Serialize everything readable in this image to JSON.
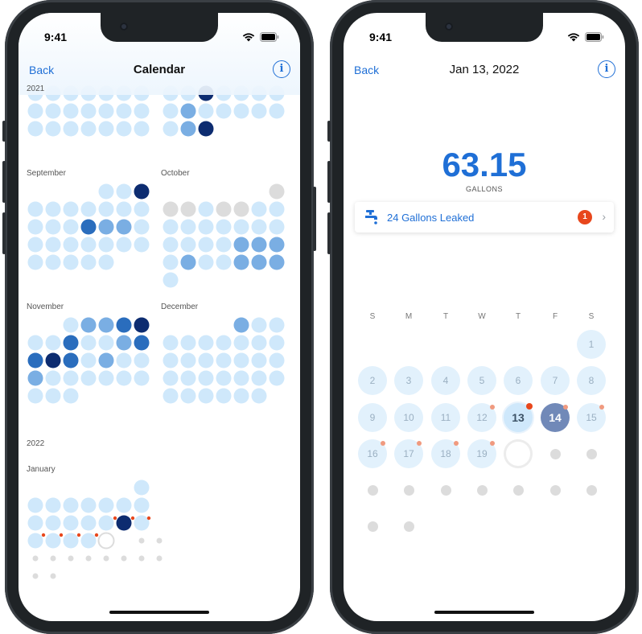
{
  "left_screen": {
    "status_time": "9:41",
    "nav": {
      "back_label": "Back",
      "title": "Calendar",
      "info_label": "i"
    },
    "year_top": "2021",
    "months": [
      {
        "label": "September"
      },
      {
        "label": "October"
      },
      {
        "label": "November"
      },
      {
        "label": "December"
      }
    ],
    "year_2022": "2022",
    "january_label": "January"
  },
  "right_screen": {
    "status_time": "9:41",
    "nav": {
      "back_label": "Back",
      "title": "Jan 13, 2022",
      "info_label": "i"
    },
    "usage": {
      "value": "63.15",
      "unit": "GALLONS"
    },
    "leak": {
      "text": "24 Gallons Leaked",
      "count": "1"
    },
    "weekdays": [
      "S",
      "M",
      "T",
      "W",
      "T",
      "F",
      "S"
    ],
    "days": [
      "1",
      "2",
      "3",
      "4",
      "5",
      "6",
      "7",
      "8",
      "9",
      "10",
      "11",
      "12",
      "13",
      "14",
      "15",
      "16",
      "17",
      "18",
      "19"
    ],
    "selected_day": "13"
  },
  "colors": {
    "accent": "#1f6fd6",
    "level_light": "#cfe8fb",
    "level_mid": "#7aaee3",
    "level_high": "#2a6dbd",
    "level_max": "#0d2c70",
    "no_data": "#dcdcdc",
    "leak_dot": "#e8471c"
  }
}
